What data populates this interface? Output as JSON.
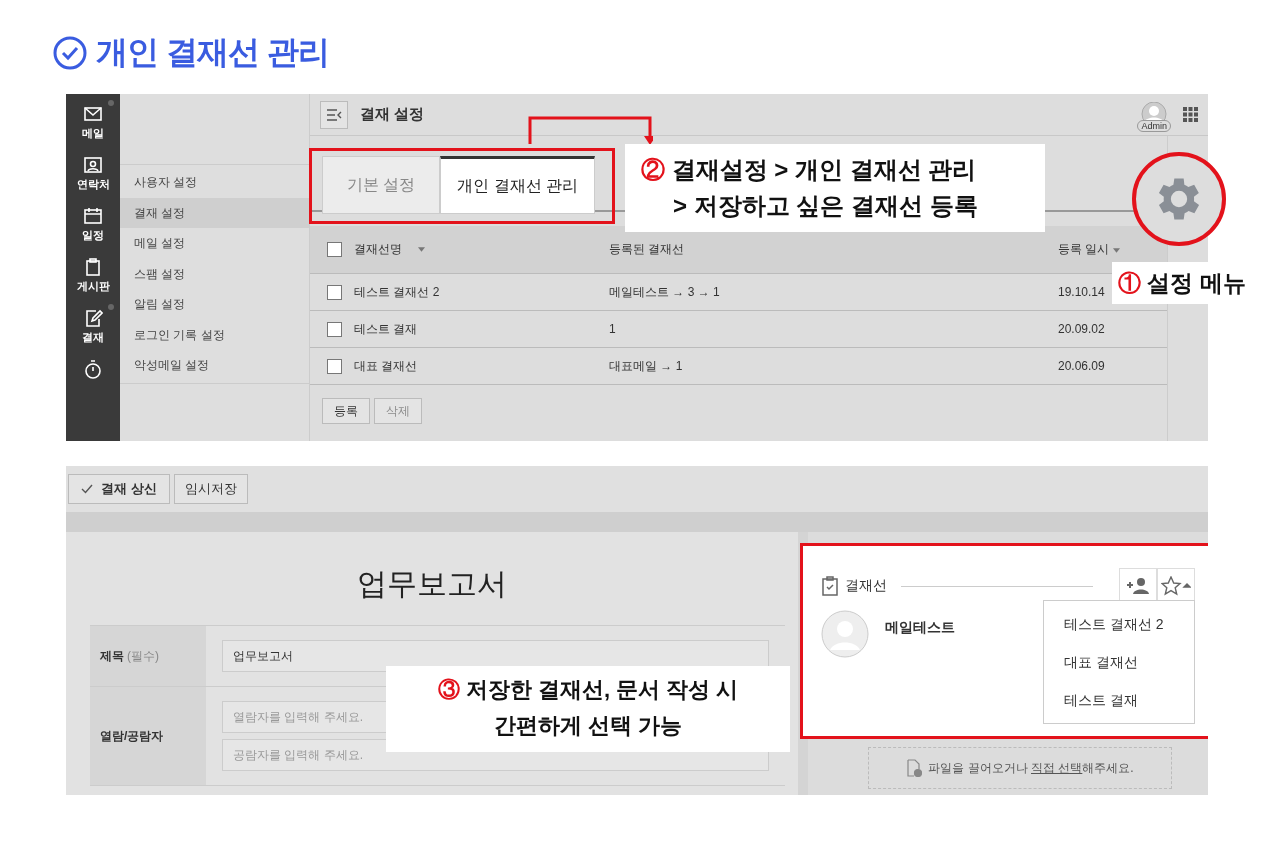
{
  "page_title": "개인 결재선 관리",
  "settings_screen": {
    "rail": [
      {
        "kind": "mail",
        "label": "메일",
        "badge": true
      },
      {
        "kind": "contacts",
        "label": "연락처"
      },
      {
        "kind": "calendar",
        "label": "일정"
      },
      {
        "kind": "board",
        "label": "게시판"
      },
      {
        "kind": "approval",
        "label": "결재",
        "badge": true
      },
      {
        "kind": "timer"
      }
    ],
    "sidebar": [
      {
        "label": "사용자 설정",
        "selected": false
      },
      {
        "label": "결재 설정",
        "selected": true
      },
      {
        "label": "메일 설정",
        "selected": false
      },
      {
        "label": "스팸 설정",
        "selected": false
      },
      {
        "label": "알림 설정",
        "selected": false
      },
      {
        "label": "로그인 기록 설정",
        "selected": false
      },
      {
        "label": "악성메일 설정",
        "selected": false
      }
    ],
    "header_title": "결재 설정",
    "avatar_label": "Admin",
    "tabs": [
      {
        "label": "기본 설정",
        "selected": false
      },
      {
        "label": "개인 결재선 관리",
        "selected": true
      }
    ],
    "table": {
      "header_checked": false,
      "columns": [
        {
          "label": "결재선명",
          "sortable": true
        },
        {
          "label": "등록된 결재선",
          "sortable": false
        },
        {
          "label": "등록 일시",
          "sortable": true
        }
      ],
      "rows": [
        {
          "checked": false,
          "cells": [
            "테스트 결재선 2",
            "메일테스트 → 3 → 1",
            "19.10.14"
          ]
        },
        {
          "checked": false,
          "cells": [
            "테스트 결재",
            "1",
            "20.09.02"
          ]
        },
        {
          "checked": false,
          "cells": [
            "대표 결재선",
            "대표메일 → 1",
            "20.06.09"
          ]
        }
      ]
    },
    "buttons": [
      {
        "label": "등록",
        "disabled": false
      },
      {
        "label": "삭제",
        "disabled": true
      }
    ]
  },
  "callouts": [
    {
      "number": "①",
      "text": "설정 메뉴"
    },
    {
      "number": "②",
      "text": "결재설정 > 개인 결재선 관리",
      "text_2": "> 저장하고 싶은 결재선 등록"
    },
    {
      "number": "③",
      "text": "저장한 결재선, 문서 작성 시",
      "text_2": "간편하게 선택 가능"
    }
  ],
  "draft_screen": {
    "toolbar": [
      {
        "label": "결재 상신",
        "kind": "submit"
      },
      {
        "label": "임시저장",
        "kind": "plain"
      }
    ],
    "document_title": "업무보고서",
    "form": [
      {
        "label": "제목",
        "note": "(필수)",
        "fields": [
          {
            "value": "업무보고서"
          }
        ]
      },
      {
        "label": "열람/공람자",
        "fields": [
          {
            "placeholder": "열람자를 입력해 주세요."
          },
          {
            "placeholder": "공람자를 입력해 주세요."
          }
        ]
      }
    ],
    "approval_panel": {
      "title": "결재선",
      "approver": "메일테스트",
      "saved_lines": [
        "테스트 결재선 2",
        "대표 결재선",
        "테스트 결재"
      ]
    },
    "file_drop": {
      "text": "파일을 끌어오거나 ",
      "link": "직접 선택",
      "text_after": "해주세요."
    }
  }
}
